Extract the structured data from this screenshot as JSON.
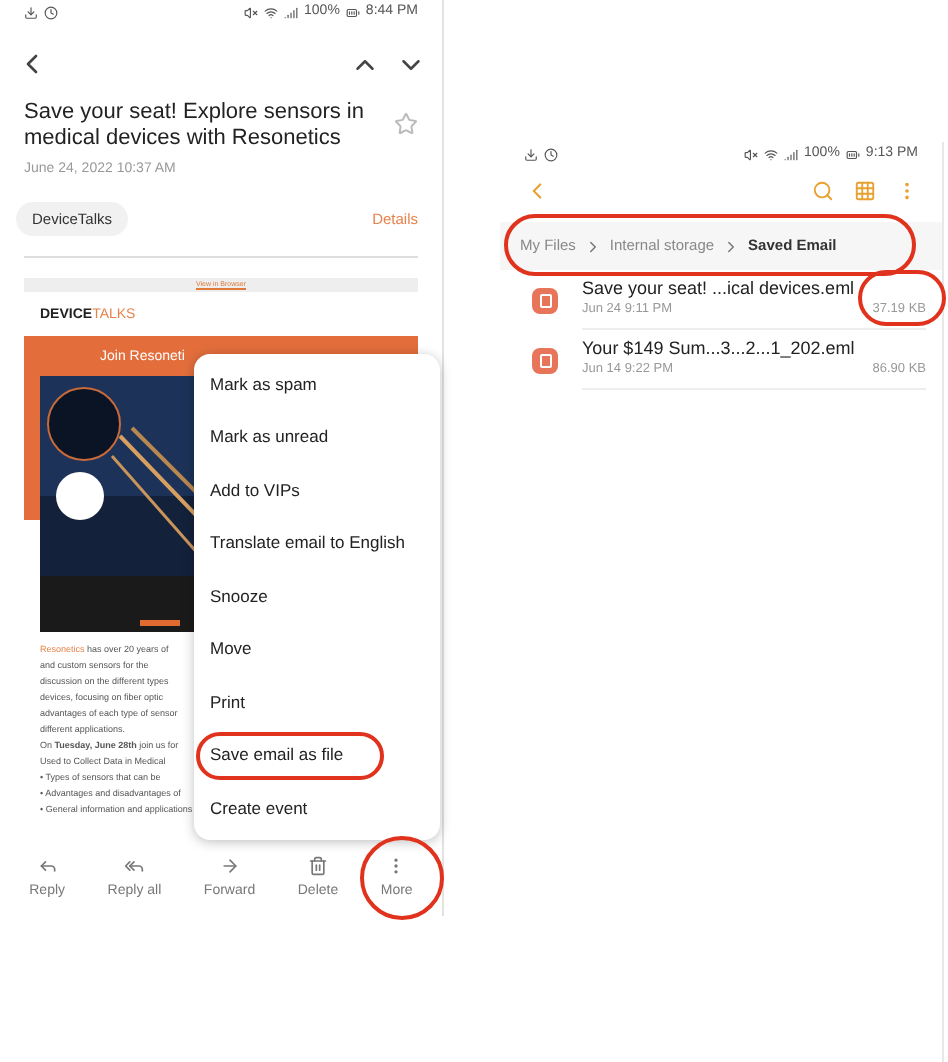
{
  "email_screen": {
    "status_bar": {
      "battery": "100%",
      "time": "8:44 PM"
    },
    "subject": "Save your seat! Explore sensors in medical devices with Resonetics",
    "starred": false,
    "date": "June 24, 2022  10:37 AM",
    "sender": "DeviceTalks",
    "details_link": "Details",
    "message": {
      "browser_link": "View in Browser",
      "logo": [
        "DEVICE",
        "TALKS"
      ],
      "banner_text": "Join Resoneti",
      "body_lines": [
        {
          "lead": "Resonetics",
          "text": " has over 20 years of"
        },
        {
          "text": "and custom sensors for the"
        },
        {
          "text": "discussion on the different types"
        },
        {
          "text": "devices, focusing on fiber optic"
        },
        {
          "text": "advantages of each type of sensor"
        },
        {
          "text": "different applications."
        },
        {
          "text": "On **Tuesday, June 28th** join us for"
        },
        {
          "text": "Used to Collect Data in Medical"
        },
        {
          "text": "• Types of sensors that can be"
        },
        {
          "text": "• Advantages and disadvantages of"
        },
        {
          "text": "• General information and applications"
        }
      ]
    },
    "menu": [
      {
        "label": "Mark as spam",
        "highlighted": false
      },
      {
        "label": "Mark as unread",
        "highlighted": false
      },
      {
        "label": "Add to VIPs",
        "highlighted": false
      },
      {
        "label": "Translate email to English",
        "highlighted": false
      },
      {
        "label": "Snooze",
        "highlighted": false
      },
      {
        "label": "Move",
        "highlighted": false
      },
      {
        "label": "Print",
        "highlighted": false
      },
      {
        "label": "Save email as file",
        "highlighted": true
      },
      {
        "label": "Create event",
        "highlighted": false
      }
    ],
    "toolbar": [
      {
        "label": "Reply",
        "highlighted": false
      },
      {
        "label": "Reply all",
        "highlighted": false
      },
      {
        "label": "Forward",
        "highlighted": false
      },
      {
        "label": "Delete",
        "highlighted": false
      },
      {
        "label": "More",
        "highlighted": true
      }
    ]
  },
  "files_screen": {
    "status_bar": {
      "battery": "100%",
      "time": "9:13 PM"
    },
    "breadcrumbs_highlighted": true,
    "breadcrumbs": [
      {
        "label": "My Files",
        "current": false
      },
      {
        "label": "Internal storage",
        "current": false
      },
      {
        "label": "Saved Email",
        "current": true
      }
    ],
    "files": [
      {
        "name": "Save your seat! ...ical devices.eml",
        "date": "Jun 24 9:11 PM",
        "size": "37.19 KB",
        "highlighted": true
      },
      {
        "name": "Your $149 Sum...3...2...1_202.eml",
        "date": "Jun 14 9:22 PM",
        "size": "86.90 KB",
        "highlighted": false
      }
    ]
  }
}
